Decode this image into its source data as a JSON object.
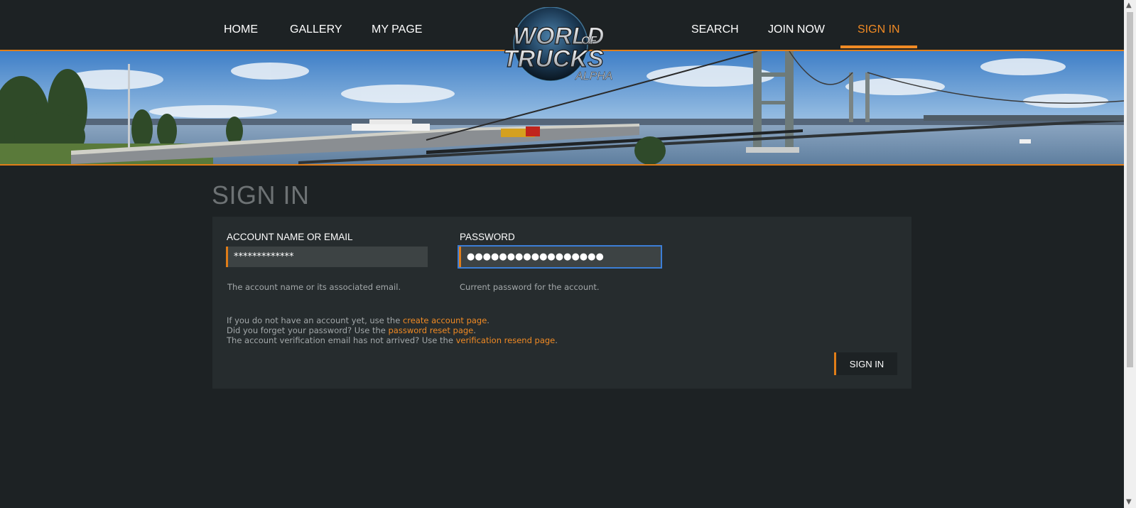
{
  "nav": {
    "left": [
      "HOME",
      "GALLERY",
      "MY PAGE"
    ],
    "right": [
      "SEARCH",
      "JOIN NOW",
      "SIGN IN"
    ],
    "active": "SIGN IN"
  },
  "logo": {
    "line1": "WORLD",
    "of": "OF",
    "line2": "TRUCKS",
    "tag": "ALPHA"
  },
  "page": {
    "title": "SIGN IN"
  },
  "form": {
    "account": {
      "label": "ACCOUNT NAME OR EMAIL",
      "value": "*************",
      "hint": "The account name or its associated email."
    },
    "password": {
      "label": "PASSWORD",
      "value": "●●●●●●●●●●●●●●●●●",
      "hint": "Current password for the account."
    },
    "info": {
      "line1_pre": "If you do not have an account yet, use the ",
      "line1_link": "create account page",
      "line1_post": ".",
      "line2_pre": "Did you forget your password? Use the ",
      "line2_link": "password reset page",
      "line2_post": ".",
      "line3_pre": "The account verification email has not arrived? Use the ",
      "line3_link": "verification resend page",
      "line3_post": "."
    },
    "submit_label": "SIGN IN"
  },
  "colors": {
    "accent": "#f08a24",
    "background": "#1d2224",
    "panel": "#262c2e",
    "input": "#3d4344",
    "focus": "#3c7ed6"
  },
  "icons": {
    "scroll_up": "chevron-up-icon",
    "scroll_down": "chevron-down-icon"
  }
}
